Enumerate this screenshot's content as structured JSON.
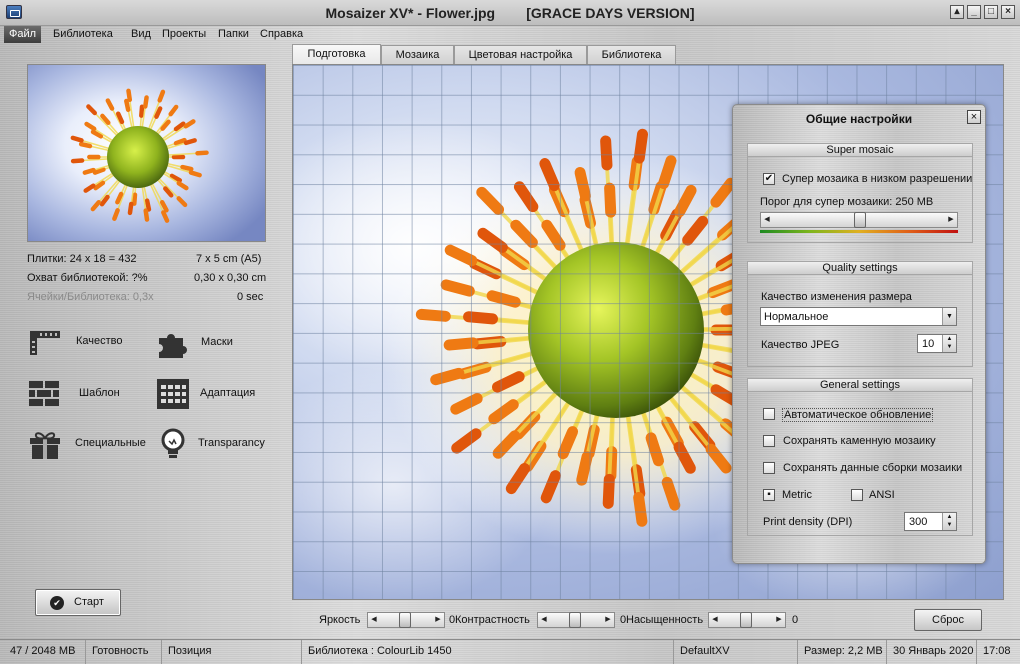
{
  "window": {
    "title": "Mosaizer XV* - Flower.jpg        [GRACE DAYS VERSION]"
  },
  "menu": [
    "Файл",
    "Библиотека",
    "Вид",
    "Проекты",
    "Папки",
    "Справка"
  ],
  "left": {
    "tiles_label": "Плитки: 24 x 18 = 432",
    "size_value": "7 x 5 cm  (A5)",
    "coverage_label": "Охват библиотекой: ?%",
    "cell_size": "0,30 x 0,30 cm",
    "cells_library": "Ячейки/Библиотека: 0,3x",
    "time_value": "0 sec",
    "tools": [
      "Качество",
      "Маски",
      "Шаблон",
      "Адаптация",
      "Специальные",
      "Transparancy"
    ],
    "start_label": "Старт"
  },
  "tabs": [
    "Подготовка",
    "Мозаика",
    "Цветовая настройка",
    "Библиотека"
  ],
  "dialog": {
    "title": "Общие настройки",
    "super_mosaic": {
      "header": "Super mosaic",
      "lowres_label": "Супер мозаика в низком разрешении",
      "lowres_checked": true,
      "threshold_label": "Порог для супер мозаики: 250 MB",
      "threshold_level": 0.5
    },
    "quality": {
      "header": "Quality settings",
      "resize_label": "Качество изменения размера",
      "resize_value": "Нормальное",
      "jpeg_label": "Качество JPEG",
      "jpeg_value": "10"
    },
    "general": {
      "header": "General settings",
      "auto_update": "Автоматическое обновление",
      "save_stone": "Сохранять каменную мозаику",
      "save_assembly": "Сохранять данные сборки мозаики",
      "metric": "Metric",
      "ansi": "ANSI",
      "metric_selected": true,
      "print_density_label": "Print density (DPI)",
      "print_density_value": "300"
    }
  },
  "adjust": {
    "brightness_label": "Яркость",
    "brightness_value": "0",
    "contrast_label": "Контрастность",
    "contrast_value": "0",
    "saturation_label": "Насыщенность",
    "saturation_value": "0",
    "reset_label": "Сброс"
  },
  "status": {
    "memory": "47 / 2048 MB",
    "state": "Готовность",
    "position": "Позиция",
    "library": "Библиотека : ColourLib 1450",
    "profile": "DefaultXV",
    "size": "Размер: 2,2 MB",
    "date": "30 Январь 2020",
    "time": "17:08"
  }
}
